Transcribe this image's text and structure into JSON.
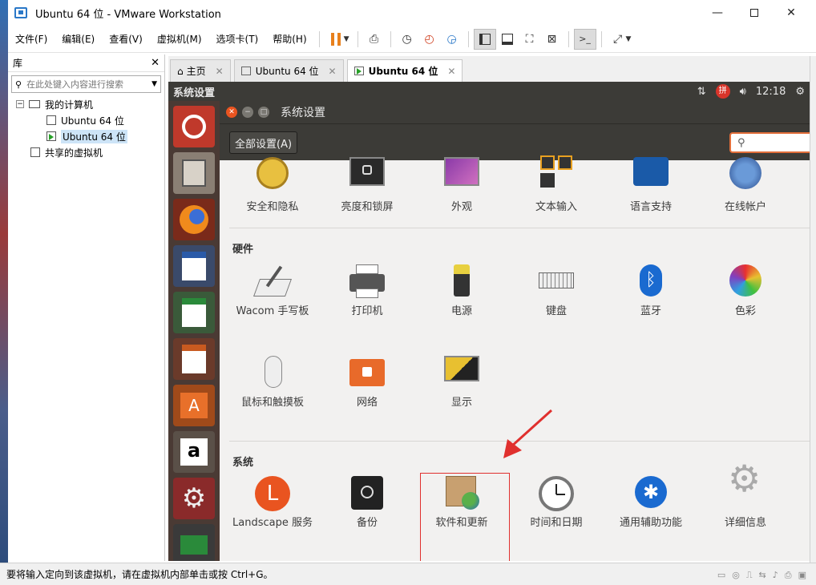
{
  "window": {
    "title": "Ubuntu 64 位 - VMware Workstation"
  },
  "menu": [
    "文件(F)",
    "编辑(E)",
    "查看(V)",
    "虚拟机(M)",
    "选项卡(T)",
    "帮助(H)"
  ],
  "library": {
    "title": "库",
    "search_placeholder": "在此处键入内容进行搜索",
    "my_computer": "我的计算机",
    "vm1": "Ubuntu 64 位",
    "vm2": "Ubuntu 64 位",
    "shared": "共享的虚拟机"
  },
  "tabs": [
    {
      "label": "主页"
    },
    {
      "label": "Ubuntu 64 位"
    },
    {
      "label": "Ubuntu 64 位"
    }
  ],
  "guest": {
    "panel_title": "系统设置",
    "clock": "12:18",
    "settings_title": "系统设置",
    "all_settings_button": "全部设置(A)",
    "personal_items": [
      "安全和隐私",
      "亮度和锁屏",
      "外观",
      "文本输入",
      "语言支持",
      "在线帐户"
    ],
    "hardware_title": "硬件",
    "hardware_items": [
      "Wacom 手写板",
      "打印机",
      "电源",
      "键盘",
      "蓝牙",
      "色彩",
      "鼠标和触摸板",
      "网络",
      "显示"
    ],
    "system_title": "系统",
    "system_items": [
      "Landscape 服务",
      "备份",
      "软件和更新",
      "时间和日期",
      "通用辅助功能",
      "详细信息"
    ]
  },
  "status": {
    "text": "要将输入定向到该虚拟机，请在虚拟机内部单击或按 Ctrl+G。"
  },
  "colors": {
    "ubuntu_orange": "#e95420",
    "highlight_red": "#e0302e",
    "launcher_bg": "#4a3a34",
    "panel_bg": "#3c3b37"
  }
}
